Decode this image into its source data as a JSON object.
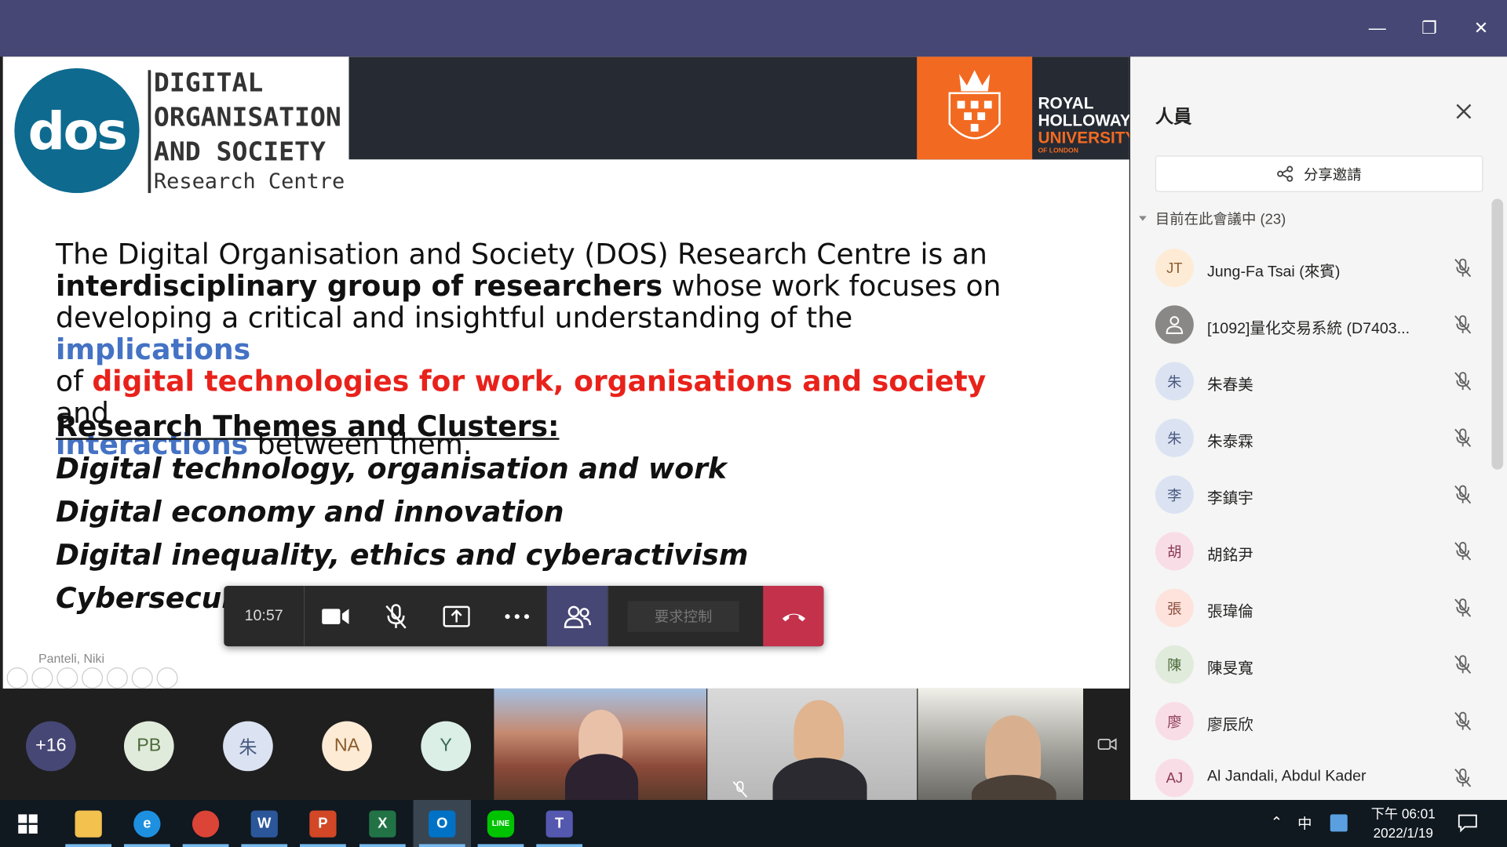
{
  "window": {
    "minimize": "—",
    "restore": "❐",
    "close": "✕"
  },
  "slide": {
    "logo_text": "dos",
    "centre_lines": [
      "DIGITAL",
      "ORGANISATION",
      "AND SOCIETY"
    ],
    "centre_sub": "Research Centre",
    "rhul": [
      "ROYAL",
      "HOLLOWAY",
      "UNIVERSITY",
      "OF LONDON"
    ],
    "para": {
      "p1": "The Digital Organisation and Society (DOS) Research Centre is an",
      "p2b": "interdisciplinary group of researchers",
      "p2": " whose work focuses on",
      "p3": "developing a critical  and insightful understanding of the ",
      "p3blue": "implications",
      "p4a": "of ",
      "p4red": "digital technologies for work, organisations and society",
      "p4b": " and",
      "p5blue": "interactions",
      "p5": " between them."
    },
    "themes_title": "Research Themes and Clusters:",
    "themes": [
      "Digital technology, organisation and work",
      "Digital economy and innovation",
      "Digital inequality, ethics and cyberactivism",
      "Cybersecurity, design and human behaviour"
    ],
    "presenter": "Panteli, Niki"
  },
  "toolbar": {
    "time": "10:57",
    "request_control": "要求控制"
  },
  "strip": {
    "avatars": [
      {
        "label": "+16",
        "bg": "#464775",
        "fg": "#ffffff"
      },
      {
        "label": "PB",
        "bg": "#e1ebdc",
        "fg": "#4b6b3a"
      },
      {
        "label": "朱",
        "bg": "#dbe3f2",
        "fg": "#4a5a80"
      },
      {
        "label": "NA",
        "bg": "#fdebd6",
        "fg": "#8a5a2a"
      },
      {
        "label": "Y",
        "bg": "#dbefe6",
        "fg": "#3a6a55"
      }
    ]
  },
  "panel": {
    "title": "人員",
    "share": "分享邀請",
    "section": "目前在此會議中 (23)",
    "people": [
      {
        "initial": "JT",
        "name": "Jung-Fa Tsai (來賓)",
        "bg": "#fdebd6",
        "fg": "#8a5a2a"
      },
      {
        "initial": "",
        "name": "[1092]量化交易系統 (D7403...",
        "bg": "#8a8886",
        "fg": "#ffffff"
      },
      {
        "initial": "朱",
        "name": "朱春美",
        "bg": "#dbe3f2",
        "fg": "#4a5a80"
      },
      {
        "initial": "朱",
        "name": "朱泰霖",
        "bg": "#dbe3f2",
        "fg": "#4a5a80"
      },
      {
        "initial": "李",
        "name": "李鎮宇",
        "bg": "#dbe3f2",
        "fg": "#4a5a80"
      },
      {
        "initial": "胡",
        "name": "胡銘尹",
        "bg": "#f9dde6",
        "fg": "#8a3a55"
      },
      {
        "initial": "張",
        "name": "張瑋倫",
        "bg": "#fde3dc",
        "fg": "#8a4a3a"
      },
      {
        "initial": "陳",
        "name": "陳旻寬",
        "bg": "#e1ebdc",
        "fg": "#4b6b3a"
      },
      {
        "initial": "廖",
        "name": "廖辰欣",
        "bg": "#f9dde6",
        "fg": "#8a3a55"
      },
      {
        "initial": "AJ",
        "name": "Al Jandali, Abdul Kader",
        "bg": "#f9dde6",
        "fg": "#8a3a55"
      }
    ]
  },
  "taskbar": {
    "clock_time": "下午 06:01",
    "clock_date": "2022/1/19",
    "ime": "中",
    "apps": [
      {
        "name": "file-explorer",
        "bg": "#f2c14e",
        "label": ""
      },
      {
        "name": "internet-explorer",
        "bg": "#1e90e0",
        "label": "e"
      },
      {
        "name": "chrome",
        "bg": "#db4437",
        "label": ""
      },
      {
        "name": "word",
        "bg": "#2b579a",
        "label": "W"
      },
      {
        "name": "powerpoint",
        "bg": "#d24726",
        "label": "P"
      },
      {
        "name": "excel",
        "bg": "#217346",
        "label": "X"
      },
      {
        "name": "outlook",
        "bg": "#0072c6",
        "label": "O"
      },
      {
        "name": "line",
        "bg": "#00c300",
        "label": "LINE"
      },
      {
        "name": "teams",
        "bg": "#5558af",
        "label": "T"
      }
    ]
  }
}
